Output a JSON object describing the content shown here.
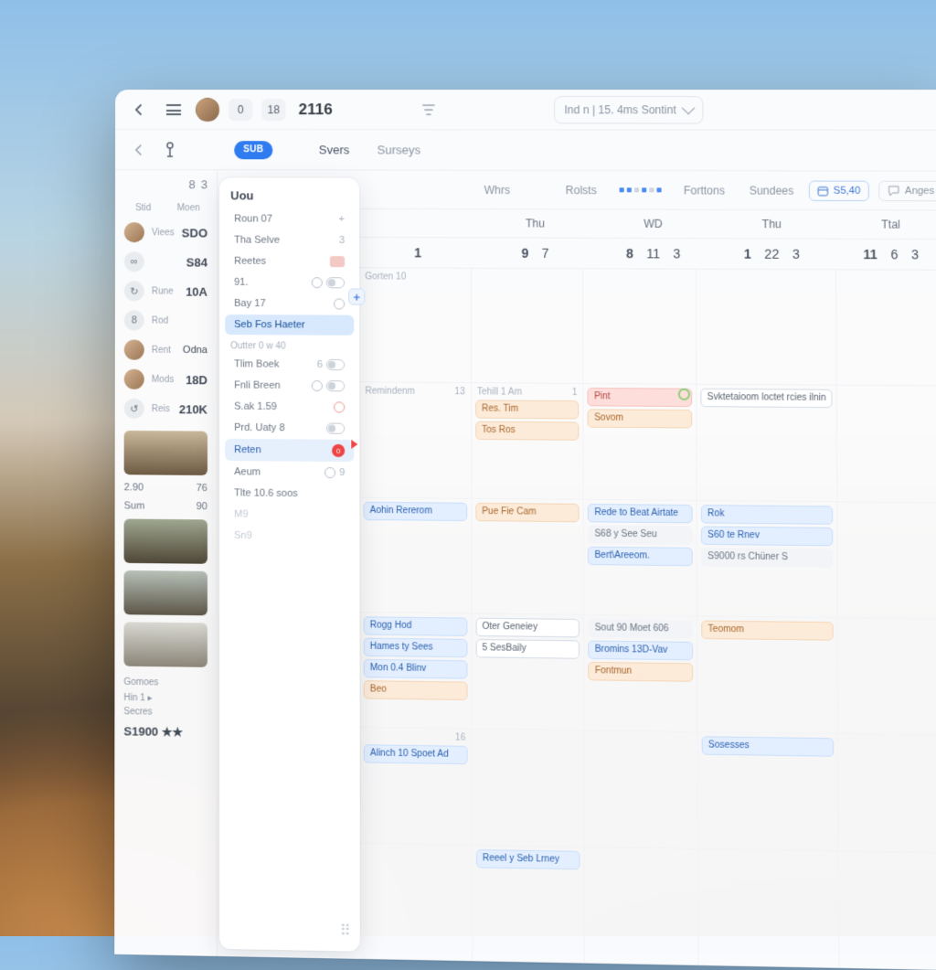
{
  "titlebar": {
    "badge1": "0",
    "badge2": "18",
    "year": "2116"
  },
  "subbar": {
    "badge": "SUB",
    "tabs": [
      "Svers",
      "Surseys"
    ],
    "dropdown": "Ind n | 15. 4ms Sontint"
  },
  "navrow": {
    "tabs": [
      "Whrs",
      "Rolsts",
      "Forttons",
      "Sundees"
    ],
    "chip_value": "S5,40",
    "chip_action": "Anges"
  },
  "weekdays": [
    "Thu",
    "WD",
    "Thu",
    "Ttal"
  ],
  "weeknums": [
    [
      "9",
      "7"
    ],
    [
      "8",
      "11",
      "3"
    ],
    [
      "1",
      "22",
      "3"
    ],
    [
      "11",
      "6",
      "3"
    ]
  ],
  "sidebar": {
    "head_a": "8",
    "head_b": "3",
    "rows": [
      {
        "icon": "A",
        "lbl": "Stid",
        "val": "",
        "sub": "Moen"
      },
      {
        "icon": "av",
        "lbl": "Viees",
        "val": "SDO"
      },
      {
        "icon": "∞",
        "lbl": "",
        "val": "S84"
      },
      {
        "icon": "↻",
        "lbl": "Rune",
        "val": "10A"
      },
      {
        "icon": "8",
        "lbl": "Rod",
        "val": ""
      },
      {
        "icon": "av",
        "lbl": "Rent",
        "val": "Odna"
      },
      {
        "icon": "av",
        "lbl": "Mods",
        "val": "18D"
      },
      {
        "icon": "↺",
        "lbl": "Reis",
        "val": "210K"
      }
    ],
    "stats": {
      "a": "2.90",
      "b": "76",
      "c": "Sum",
      "d": "90"
    },
    "footer": {
      "a": "Gomoes",
      "b": "Hin 1 ▸",
      "c": "Secres",
      "price": "S1900 ★★"
    }
  },
  "panel": {
    "title": "Uou",
    "rows": [
      {
        "t": "Roun 07",
        "rt": "+",
        "cls": ""
      },
      {
        "t": "Tha Selve",
        "rt": "3",
        "cls": ""
      },
      {
        "t": "Reetes",
        "rt": "badge",
        "cls": ""
      },
      {
        "t": "91.",
        "rt": "ring tog",
        "cls": ""
      },
      {
        "t": "Bay 17",
        "rt": "ring",
        "cls": ""
      },
      {
        "t": "Seb Fos Haeter",
        "rt": "",
        "cls": "sel"
      },
      {
        "t": "Outter 0 w 40",
        "rt": "",
        "cls": "sub"
      },
      {
        "t": "Tlim Boek",
        "rt": "6 tog",
        "cls": ""
      },
      {
        "t": "Fnli Breen",
        "rt": "ring tog",
        "cls": ""
      },
      {
        "t": "S.ak 1.59",
        "rt": "ring-red",
        "cls": ""
      },
      {
        "t": "Prd. Uaty 8",
        "rt": "tog",
        "cls": ""
      },
      {
        "t": "Reten",
        "rt": "alert",
        "cls": "sel2"
      },
      {
        "t": "Aeum",
        "rt": "ring 9",
        "cls": ""
      },
      {
        "t": "Tlte 10.6 soos",
        "rt": "",
        "cls": ""
      },
      {
        "t": "M9",
        "rt": "",
        "cls": "faint"
      },
      {
        "t": "Sn9",
        "rt": "",
        "cls": "faint"
      }
    ]
  },
  "calendar_firstcol_dates": [
    "1",
    "13",
    "16"
  ],
  "events": {
    "r0": [
      {
        "c": 0,
        "txt": "Gorten 10",
        "cls": "gray"
      }
    ],
    "r1": [
      {
        "c": 0,
        "txt": "Remindenm",
        "cls": "meta",
        "extra": "13"
      },
      {
        "c": 1,
        "txt": "Tehill 1 Am",
        "cls": "meta",
        "extra": "1"
      },
      {
        "c": 3,
        "txt": "Svktetaioom loctet rcies ilnin",
        "cls": "outline"
      }
    ],
    "r1b": [
      {
        "c": 1,
        "txt": "Res. Tim",
        "cls": "orange"
      },
      {
        "c": 2,
        "txt": "Pint",
        "cls": "red"
      },
      {
        "c": 1,
        "txt": "Tos Ros",
        "cls": "orange"
      },
      {
        "c": 2,
        "txt": "Sovom",
        "cls": "orange"
      }
    ],
    "r2": [
      {
        "c": 0,
        "txt": "Aohin Rererom",
        "cls": "blue"
      },
      {
        "c": 1,
        "txt": "Pue Fie Cam",
        "cls": "orange"
      },
      {
        "c": 2,
        "txt": "Rede to Beat Airtate",
        "cls": "blue"
      },
      {
        "c": 2,
        "txt": "S68 y See Seu",
        "cls": "gray"
      },
      {
        "c": 2,
        "txt": "Bert\\Areeom.",
        "cls": "blue"
      },
      {
        "c": 3,
        "txt": "Rok",
        "cls": "blue"
      },
      {
        "c": 3,
        "txt": "S60 te Rnev",
        "cls": "blue"
      },
      {
        "c": 3,
        "txt": "S9000 rs Chüner S",
        "cls": "gray"
      }
    ],
    "r3": [
      {
        "c": 0,
        "txt": "Rogg Hod",
        "cls": "blue"
      },
      {
        "c": 1,
        "txt": "Oter Geneiey",
        "cls": "outline"
      },
      {
        "c": 2,
        "txt": "Sout 90 Moet 606",
        "cls": "gray"
      },
      {
        "c": 0,
        "txt": "Hames ty Sees",
        "cls": "blue"
      },
      {
        "c": 2,
        "txt": "Bromins 13D-Vav",
        "cls": "blue"
      },
      {
        "c": 0,
        "txt": "Mon 0.4 Blinv",
        "cls": "blue"
      },
      {
        "c": 2,
        "txt": "Fontmun",
        "cls": "orange"
      },
      {
        "c": 3,
        "txt": "Teomom",
        "cls": "orange"
      },
      {
        "c": 0,
        "txt": "Beo",
        "cls": "orange"
      },
      {
        "c": 1,
        "txt": "5 SesBaily",
        "cls": "outline"
      }
    ],
    "r4": [
      {
        "c": 0,
        "txt": "Alinch 10 Spoet Ad",
        "cls": "blue"
      },
      {
        "c": 3,
        "txt": "Sosesses",
        "cls": "blue"
      },
      {
        "c": 1,
        "txt": "Reeel y Seb Lrney",
        "cls": "blue"
      }
    ]
  }
}
